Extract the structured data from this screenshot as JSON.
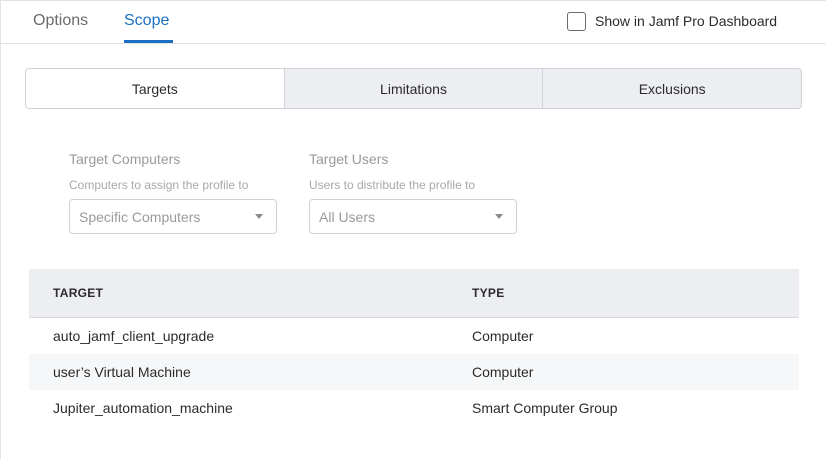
{
  "top_tabs": [
    {
      "label": "Options",
      "active": false
    },
    {
      "label": "Scope",
      "active": true
    }
  ],
  "dashboard_checkbox": {
    "label": "Show in Jamf Pro Dashboard",
    "checked": false
  },
  "scope_tabs": [
    {
      "label": "Targets",
      "active": true
    },
    {
      "label": "Limitations",
      "active": false
    },
    {
      "label": "Exclusions",
      "active": false
    }
  ],
  "target_computers": {
    "title": "Target Computers",
    "subtitle": "Computers to assign the profile to",
    "selected": "Specific Computers"
  },
  "target_users": {
    "title": "Target Users",
    "subtitle": "Users to distribute the profile to",
    "selected": "All Users"
  },
  "table": {
    "columns": [
      "TARGET",
      "TYPE"
    ],
    "rows": [
      {
        "target": "auto_jamf_client_upgrade",
        "type": "Computer"
      },
      {
        "target": "user’s Virtual Machine",
        "type": "Computer"
      },
      {
        "target": "Jupiter_automation_machine",
        "type": "Smart Computer Group"
      }
    ]
  },
  "colors": {
    "accent": "#1a6fc4",
    "header_bg": "#eceef1",
    "border": "#cfd3d8"
  }
}
